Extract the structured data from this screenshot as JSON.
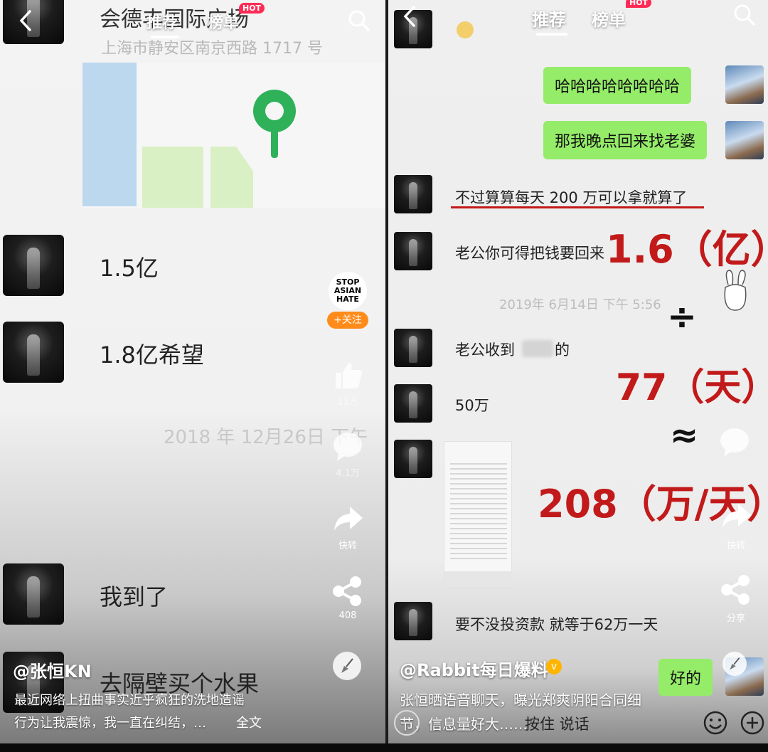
{
  "left": {
    "nav": {
      "recommend": "推荐",
      "ranking": "榜单",
      "hot": "HOT"
    },
    "location": {
      "name": "会德丰国际广场",
      "address": "上海市静安区南京西路 1717 号"
    },
    "messages": [
      {
        "text": "1.5亿"
      },
      {
        "text": "1.8亿希望"
      },
      {
        "text": "我到了"
      },
      {
        "text": "去隔壁买个水果"
      }
    ],
    "timestamp": "2018 年 12月26日  下午",
    "follow": {
      "logo": "STOP ASIAN HATE",
      "label": "+关注"
    },
    "side": {
      "like_count": "11万",
      "comment_count": "4.1万",
      "share_label": "快转",
      "forward_count": "408"
    },
    "author": "@张恒KN",
    "caption_line1": "最近网络上扭曲事实近乎疯狂的洗地造谣",
    "caption_line2": "行为让我震惊，我一直在纠结，…",
    "caption_more": "全文"
  },
  "right": {
    "nav": {
      "recommend": "推荐",
      "ranking": "榜单",
      "hot": "HOT"
    },
    "messages_out": [
      {
        "text": "哈哈哈哈哈哈哈哈"
      },
      {
        "text": "那我晚点回来找老婆"
      },
      {
        "text": "好的"
      }
    ],
    "messages_in": [
      {
        "text": "不过算算每天 200 万可以拿就算了"
      },
      {
        "text": "老公你可得把钱要回来"
      },
      {
        "text": "老公收到"
      },
      {
        "text": "50万"
      },
      {
        "text": "要不没投资款 就等于62万一天"
      }
    ],
    "blurred_suffix": "的",
    "timestamp": "2019年 6月14日 下午 5:56",
    "overlay": {
      "line1": "1.6（亿）",
      "div": "÷",
      "line2": "77（天）",
      "approx": "≈",
      "line3": "208（万/天）"
    },
    "side": {
      "share_label": "快转",
      "share2_label": "分享"
    },
    "author": "@Rabbit每日爆料",
    "caption_line1": "张恒晒语音聊天，曝光郑爽阴阳合同细",
    "caption_line2": "节，信息量好大……",
    "voice_label": "按住 说话",
    "colors": {
      "accent_red": "#c21a1a",
      "wechat_green": "#95ec69",
      "hot_badge": "#fe2c55",
      "follow_orange": "#ff8c1a"
    }
  }
}
